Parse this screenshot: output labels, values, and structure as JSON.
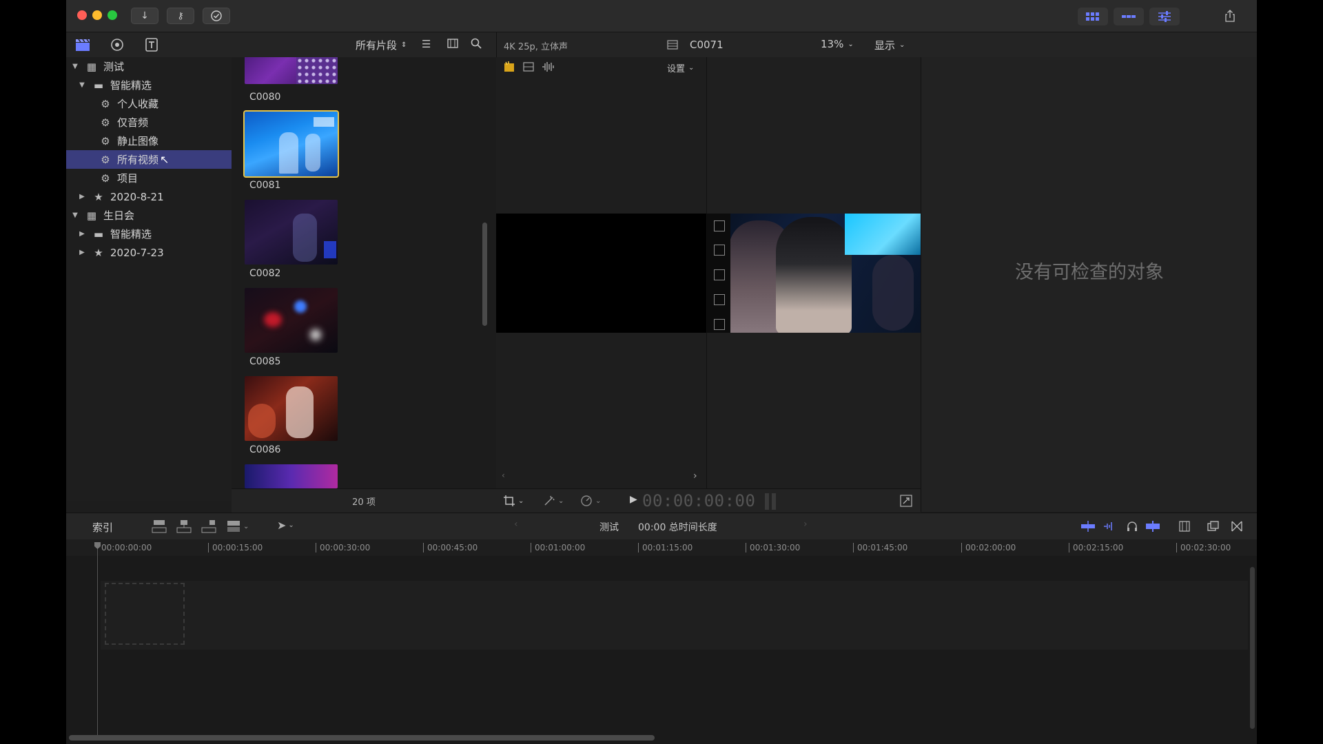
{
  "toolbar": {
    "import_icon": "download-arrow-icon",
    "keyword_icon": "key-icon",
    "check_icon": "checkmark-circle-icon",
    "share_icon": "share-icon"
  },
  "sidebar": {
    "items": [
      {
        "label": "测试",
        "kind": "library",
        "expanded": true
      },
      {
        "label": "智能精选",
        "kind": "folder",
        "expanded": true
      },
      {
        "label": "个人收藏",
        "kind": "smart"
      },
      {
        "label": "仅音频",
        "kind": "smart"
      },
      {
        "label": "静止图像",
        "kind": "smart"
      },
      {
        "label": "所有视频",
        "kind": "smart",
        "selected": true
      },
      {
        "label": "项目",
        "kind": "smart"
      },
      {
        "label": "2020-8-21",
        "kind": "event"
      },
      {
        "label": "生日会",
        "kind": "library",
        "expanded": true
      },
      {
        "label": "智能精选",
        "kind": "folder"
      },
      {
        "label": "2020-7-23",
        "kind": "event"
      }
    ]
  },
  "browser": {
    "filter_label": "所有片段",
    "count_label": "20 项",
    "clips": [
      {
        "name": "C0080"
      },
      {
        "name": "C0081",
        "selected": true
      },
      {
        "name": "C0082"
      },
      {
        "name": "C0085"
      },
      {
        "name": "C0086"
      }
    ]
  },
  "viewer": {
    "format_label": "4K 25p, 立体声",
    "clip_name": "C0071",
    "zoom_label": "13%",
    "display_label": "显示",
    "settings_label": "设置",
    "timecode": "00:00:00:00"
  },
  "inspector": {
    "empty_message": "没有可检查的对象"
  },
  "timeline": {
    "index_label": "索引",
    "project_name": "测试",
    "duration_label": "00:00 总时间长度",
    "ruler": [
      "00:00:00:00",
      "00:00:15:00",
      "00:00:30:00",
      "00:00:45:00",
      "00:01:00:00",
      "00:01:15:00",
      "00:01:30:00",
      "00:01:45:00",
      "00:02:00:00",
      "00:02:15:00",
      "00:02:30:00"
    ]
  },
  "colors": {
    "accent": "#3a3d7e",
    "selection_border": "#e6c44a",
    "window_bg": "#1d1d1d",
    "close": "#ff5f57",
    "minimize": "#febc2e",
    "zoom": "#28c840"
  }
}
